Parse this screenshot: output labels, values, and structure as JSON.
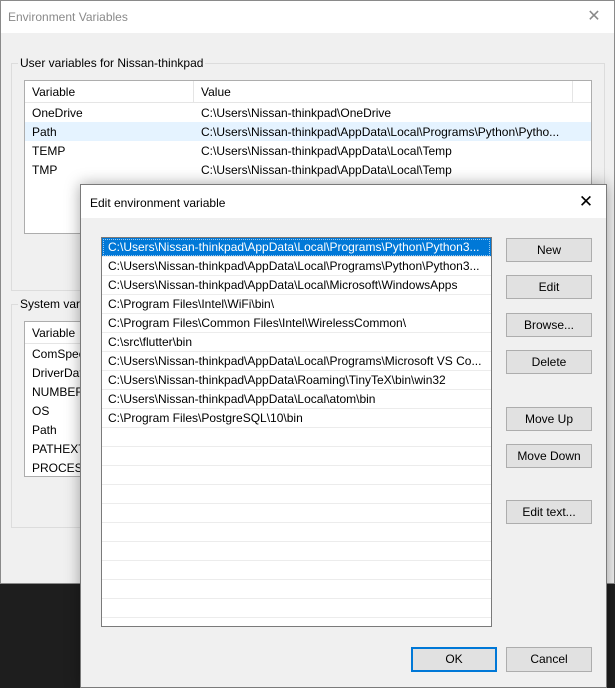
{
  "env_window": {
    "title": "Environment Variables",
    "close_glyph": "✕",
    "user_group_label": "User variables for Nissan-thinkpad",
    "user_columns": [
      "Variable",
      "Value"
    ],
    "user_rows": [
      {
        "variable": "OneDrive",
        "value": "C:\\Users\\Nissan-thinkpad\\OneDrive"
      },
      {
        "variable": "Path",
        "value": "C:\\Users\\Nissan-thinkpad\\AppData\\Local\\Programs\\Python\\Pytho..."
      },
      {
        "variable": "TEMP",
        "value": "C:\\Users\\Nissan-thinkpad\\AppData\\Local\\Temp"
      },
      {
        "variable": "TMP",
        "value": "C:\\Users\\Nissan-thinkpad\\AppData\\Local\\Temp"
      }
    ],
    "user_selected_row": 1,
    "system_group_label": "System vari",
    "system_column": "Variable",
    "system_rows": [
      "ComSpec",
      "DriverDat",
      "NUMBER_",
      "OS",
      "Path",
      "PATHEXT",
      "PROCESS"
    ]
  },
  "edit_dialog": {
    "title": "Edit environment variable",
    "close_glyph": "✕",
    "paths": [
      "C:\\Users\\Nissan-thinkpad\\AppData\\Local\\Programs\\Python\\Python3...",
      "C:\\Users\\Nissan-thinkpad\\AppData\\Local\\Programs\\Python\\Python3...",
      "C:\\Users\\Nissan-thinkpad\\AppData\\Local\\Microsoft\\WindowsApps",
      "C:\\Program Files\\Intel\\WiFi\\bin\\",
      "C:\\Program Files\\Common Files\\Intel\\WirelessCommon\\",
      "C:\\src\\flutter\\bin",
      "C:\\Users\\Nissan-thinkpad\\AppData\\Local\\Programs\\Microsoft VS Co...",
      "C:\\Users\\Nissan-thinkpad\\AppData\\Roaming\\TinyTeX\\bin\\win32",
      "C:\\Users\\Nissan-thinkpad\\AppData\\Local\\atom\\bin",
      "C:\\Program Files\\PostgreSQL\\10\\bin"
    ],
    "selected_index": 0,
    "buttons": {
      "new": "New",
      "edit": "Edit",
      "browse": "Browse...",
      "delete": "Delete",
      "move_up": "Move Up",
      "move_down": "Move Down",
      "edit_text": "Edit text...",
      "ok": "OK",
      "cancel": "Cancel"
    }
  },
  "colors": {
    "selection": "#0078d7",
    "dialog_background": "#f0f0f0",
    "backdrop": "#1e1e1e"
  }
}
